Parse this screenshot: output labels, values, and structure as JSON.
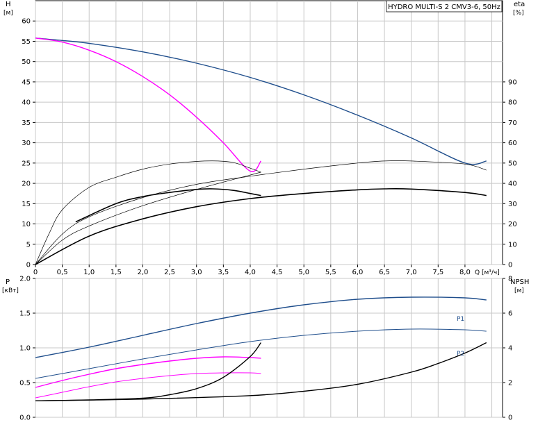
{
  "chart_data": [
    {
      "type": "line",
      "title": "HYDRO MULTI-S 2 CMV3-6, 50Hz",
      "x_axis": {
        "label": "Q [м³/ч]",
        "range": [
          0,
          8.7
        ],
        "ticks": [
          0,
          0.5,
          1,
          1.5,
          2,
          2.5,
          3,
          3.5,
          4,
          4.5,
          5,
          5.5,
          6,
          6.5,
          7,
          7.5,
          8
        ],
        "tick_labels": [
          "0",
          "0,5",
          "1,0",
          "1,5",
          "2,0",
          "2,5",
          "3,0",
          "3,5",
          "4,0",
          "4,5",
          "5,0",
          "5,5",
          "6,0",
          "6,5",
          "7,0",
          "7,5",
          "8,0"
        ],
        "vertical_grid": [
          0,
          0.5,
          1,
          1.5,
          2,
          2.5,
          3,
          3.5,
          4,
          4.5,
          5,
          5.5,
          6,
          6.5,
          7,
          7.5,
          8,
          8.5
        ]
      },
      "y_left": {
        "label_top": "H",
        "label_unit": "[м]",
        "range": [
          0,
          65
        ],
        "ticks": [
          0,
          5,
          10,
          15,
          20,
          25,
          30,
          35,
          40,
          45,
          50,
          55,
          60
        ]
      },
      "y_right": {
        "label_top": "eta",
        "label_unit": "[%]",
        "range": [
          0,
          130
        ],
        "ticks": [
          0,
          10,
          20,
          30,
          40,
          50,
          60,
          70,
          80,
          90
        ]
      },
      "grid": true,
      "series": [
        {
          "role": "head-system",
          "axis": "left",
          "color": "#1f4e8c",
          "width": 1.4,
          "x": [
            0,
            0.5,
            1,
            2,
            3,
            4,
            5,
            6,
            7,
            8,
            8.4
          ],
          "y": [
            55.8,
            55.2,
            54.5,
            52.4,
            49.6,
            46.1,
            41.8,
            36.8,
            31.2,
            25.0,
            25.5
          ]
        },
        {
          "role": "head-single-pump",
          "axis": "left",
          "color": "#ff00ff",
          "width": 1.4,
          "x": [
            0,
            0.5,
            1,
            1.5,
            2,
            2.5,
            3,
            3.5,
            4,
            4.2
          ],
          "y": [
            55.8,
            54.8,
            52.8,
            50.0,
            46.3,
            41.8,
            36.3,
            30.0,
            23.0,
            25.5
          ]
        },
        {
          "role": "eta-single-pump",
          "axis": "right",
          "color": "#000000",
          "width": 0.7,
          "x": [
            0,
            0.25,
            0.5,
            1,
            1.5,
            2,
            2.5,
            3,
            3.4,
            3.7,
            4,
            4.2
          ],
          "y": [
            0,
            15,
            27,
            38,
            43,
            47,
            49.5,
            50.8,
            51,
            50.2,
            47.5,
            45.5
          ]
        },
        {
          "role": "eta-system",
          "axis": "right",
          "color": "#000000",
          "width": 0.7,
          "x": [
            0,
            0.5,
            1,
            2,
            3,
            4,
            5,
            6,
            6.5,
            7,
            8,
            8.4
          ],
          "y": [
            0,
            15,
            23.5,
            33,
            39.5,
            43.5,
            47,
            50,
            51,
            51,
            49.5,
            46.5
          ]
        },
        {
          "role": "eta-blend",
          "axis": "right",
          "color": "#000000",
          "width": 0.7,
          "x": [
            0,
            0.5,
            1,
            2,
            3,
            4.2
          ],
          "y": [
            0,
            12,
            19,
            29,
            37,
            45.5
          ]
        },
        {
          "role": "eta-system-bold",
          "axis": "right",
          "color": "#000000",
          "width": 1.6,
          "x": [
            0.75,
            1.5,
            2,
            2.5,
            3,
            3.3,
            3.7,
            4,
            4.2
          ],
          "y": [
            21,
            30,
            33.5,
            35.5,
            37,
            37.3,
            36.5,
            35,
            34
          ]
        },
        {
          "role": "eta-system-bold-2",
          "axis": "right",
          "color": "#000000",
          "width": 1.6,
          "x": [
            0,
            1,
            2,
            3,
            4,
            5,
            6,
            6.5,
            7,
            8,
            8.4
          ],
          "y": [
            0,
            14,
            22.5,
            28.5,
            32.5,
            35,
            36.8,
            37.3,
            37.2,
            35.5,
            34
          ]
        }
      ]
    },
    {
      "type": "line",
      "title": "",
      "x_axis": {
        "range": [
          0,
          8.7
        ],
        "vertical_grid": [
          0,
          0.5,
          1,
          1.5,
          2,
          2.5,
          3,
          3.5,
          4,
          4.5,
          5,
          5.5,
          6,
          6.5,
          7,
          7.5,
          8,
          8.5
        ]
      },
      "y_left": {
        "label_top": "P",
        "label_unit": "[кВт]",
        "range": [
          0,
          2.0
        ],
        "ticks": [
          0,
          0.5,
          1.0,
          1.5,
          2.0
        ],
        "tick_labels": [
          "0.0",
          "0.5",
          "1.0",
          "1.5",
          "2.0"
        ]
      },
      "y_right": {
        "label_top": "NPSH",
        "label_unit": "[м]",
        "range": [
          0,
          8
        ],
        "ticks": [
          0,
          2,
          4,
          6,
          8
        ]
      },
      "grid": true,
      "series": [
        {
          "name": "P1",
          "axis": "left",
          "color": "#1f4e8c",
          "width": 1.4,
          "x": [
            0,
            1,
            2,
            3,
            4,
            5,
            6,
            7,
            8,
            8.4
          ],
          "y": [
            0.86,
            1.01,
            1.18,
            1.35,
            1.5,
            1.62,
            1.7,
            1.73,
            1.72,
            1.69
          ]
        },
        {
          "name": "P2",
          "axis": "left",
          "color": "#1f4e8c",
          "width": 1.0,
          "x": [
            0,
            1,
            2,
            3,
            4,
            5,
            6,
            7,
            8,
            8.4
          ],
          "y": [
            0.56,
            0.7,
            0.84,
            0.97,
            1.09,
            1.18,
            1.24,
            1.27,
            1.26,
            1.24
          ]
        },
        {
          "role": "P1-single-pump",
          "axis": "left",
          "color": "#ff00ff",
          "width": 1.4,
          "x": [
            0,
            0.5,
            1,
            1.5,
            2,
            2.5,
            3,
            3.5,
            4,
            4.2
          ],
          "y": [
            0.43,
            0.53,
            0.62,
            0.7,
            0.76,
            0.81,
            0.85,
            0.87,
            0.86,
            0.85
          ]
        },
        {
          "role": "P2-single-pump",
          "axis": "left",
          "color": "#ff00ff",
          "width": 1.0,
          "x": [
            0,
            0.5,
            1,
            1.5,
            2,
            2.5,
            3,
            3.5,
            4,
            4.2
          ],
          "y": [
            0.28,
            0.36,
            0.44,
            0.51,
            0.56,
            0.6,
            0.63,
            0.64,
            0.64,
            0.63
          ]
        },
        {
          "role": "npsh-single-pump",
          "axis": "right",
          "color": "#000000",
          "width": 1.4,
          "x": [
            0,
            1,
            2,
            2.5,
            3,
            3.5,
            4,
            4.2
          ],
          "y": [
            0.95,
            1.0,
            1.1,
            1.3,
            1.65,
            2.3,
            3.5,
            4.3
          ]
        },
        {
          "role": "npsh-system",
          "axis": "right",
          "color": "#000000",
          "width": 1.4,
          "x": [
            0,
            2,
            4,
            5,
            6,
            7,
            7.5,
            8,
            8.4
          ],
          "y": [
            0.95,
            1.05,
            1.25,
            1.5,
            1.9,
            2.6,
            3.1,
            3.7,
            4.3
          ]
        }
      ]
    }
  ]
}
